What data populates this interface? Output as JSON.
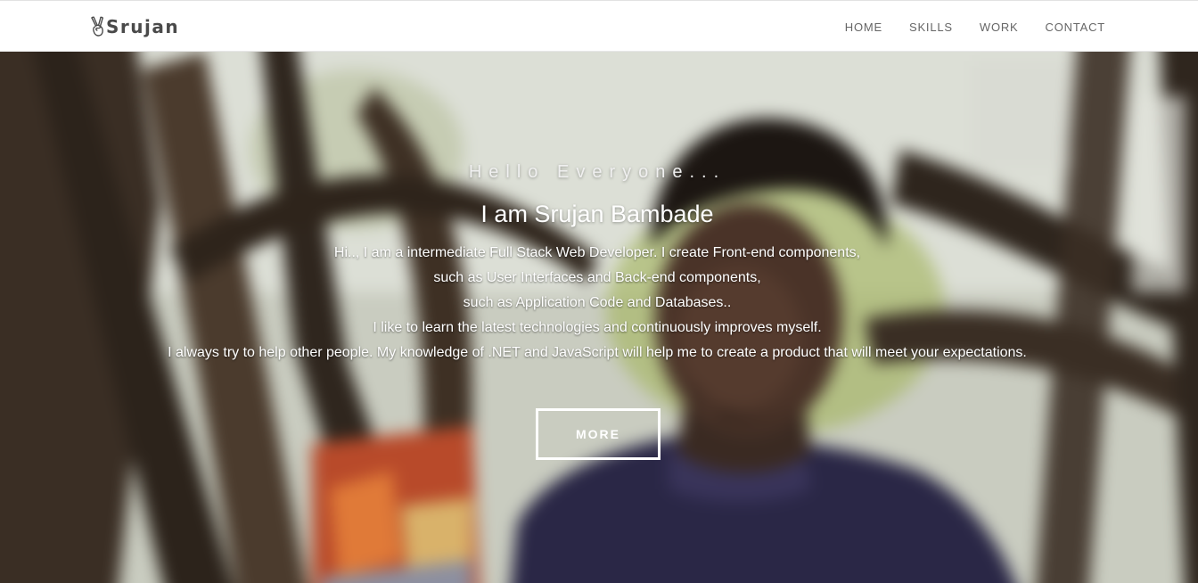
{
  "navbar": {
    "brand_icon": "victory-hand-icon",
    "brand_name": "Srujan",
    "links": [
      {
        "label": "HOME"
      },
      {
        "label": "SKILLS"
      },
      {
        "label": "WORK"
      },
      {
        "label": "CONTACT"
      }
    ]
  },
  "hero": {
    "greeting": "Hello Everyone...",
    "headline": "I am Srujan Bambade",
    "intro_lines": [
      "Hi.., I am a intermediate Full Stack Web Developer. I create Front-end components,",
      "such as User Interfaces and Back-end components,",
      "such as Application Code and Databases..",
      "I like to learn the latest technologies and continuously improves myself.",
      "I always try to help other people. My knowledge of .NET and JavaScript will help me to create a product that will meet your expectations."
    ],
    "more_label": "MORE",
    "background": "blurred-photo-of-person-under-banyan-tree"
  },
  "colors": {
    "navbar_bg": "#ffffff",
    "nav_text": "#666666",
    "brand_text": "#4a4a4a",
    "hero_text": "#ffffff",
    "button_border": "#ffffff"
  }
}
